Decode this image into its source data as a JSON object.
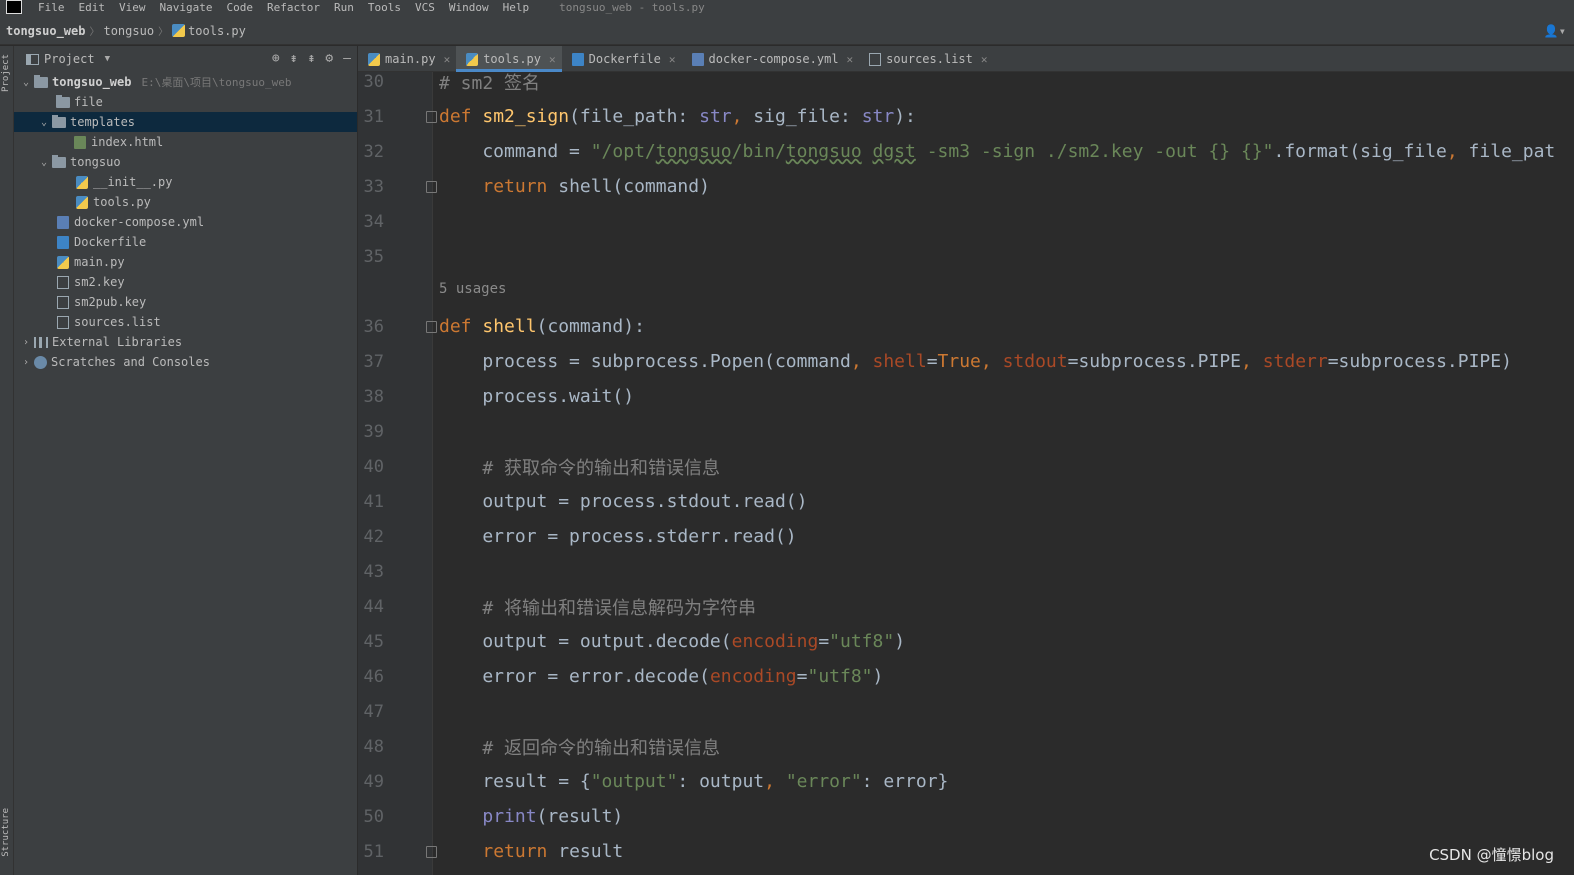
{
  "menubar": {
    "items": [
      "File",
      "Edit",
      "View",
      "Navigate",
      "Code",
      "Refactor",
      "Run",
      "Tools",
      "VCS",
      "Window",
      "Help"
    ],
    "window_title": "tongsuo_web - tools.py"
  },
  "breadcrumb": {
    "project": "tongsuo_web",
    "folder": "tongsuo",
    "file": "tools.py"
  },
  "left_strip": {
    "project_label": "Project",
    "structure_label": "Structure"
  },
  "project_panel": {
    "title": "Project",
    "tree": [
      {
        "label": "tongsuo_web",
        "path": "E:\\桌面\\项目\\tongsuo_web",
        "expanded": true
      },
      {
        "label": "file"
      },
      {
        "label": "templates",
        "expanded": true,
        "selected": true
      },
      {
        "label": "index.html"
      },
      {
        "label": "tongsuo",
        "expanded": true
      },
      {
        "label": "__init__.py"
      },
      {
        "label": "tools.py"
      },
      {
        "label": "docker-compose.yml"
      },
      {
        "label": "Dockerfile"
      },
      {
        "label": "main.py"
      },
      {
        "label": "sm2.key"
      },
      {
        "label": "sm2pub.key"
      },
      {
        "label": "sources.list"
      },
      {
        "label": "External Libraries"
      },
      {
        "label": "Scratches and Consoles"
      }
    ]
  },
  "tabs": [
    {
      "label": "main.py",
      "icon": "python-file-icon"
    },
    {
      "label": "tools.py",
      "icon": "python-file-icon",
      "active": true
    },
    {
      "label": "Dockerfile",
      "icon": "docker-file-icon"
    },
    {
      "label": "docker-compose.yml",
      "icon": "docker-compose-icon"
    },
    {
      "label": "sources.list",
      "icon": "text-file-icon"
    }
  ],
  "editor": {
    "usages_hint": "5 usages",
    "lines": [
      {
        "n": "30",
        "text": "# sm2 签名"
      },
      {
        "n": "31",
        "text": "def sm2_sign(file_path: str, sig_file: str):"
      },
      {
        "n": "32",
        "text": "    command = \"/opt/tongsuo/bin/tongsuo dgst -sm3 -sign ./sm2.key -out {} {}\".format(sig_file, file_pat"
      },
      {
        "n": "33",
        "text": "    return shell(command)"
      },
      {
        "n": "34",
        "text": ""
      },
      {
        "n": "35",
        "text": ""
      },
      {
        "n": "36",
        "text": "def shell(command):"
      },
      {
        "n": "37",
        "text": "    process = subprocess.Popen(command, shell=True, stdout=subprocess.PIPE, stderr=subprocess.PIPE)"
      },
      {
        "n": "38",
        "text": "    process.wait()"
      },
      {
        "n": "39",
        "text": ""
      },
      {
        "n": "40",
        "text": "    # 获取命令的输出和错误信息"
      },
      {
        "n": "41",
        "text": "    output = process.stdout.read()"
      },
      {
        "n": "42",
        "text": "    error = process.stderr.read()"
      },
      {
        "n": "43",
        "text": ""
      },
      {
        "n": "44",
        "text": "    # 将输出和错误信息解码为字符串"
      },
      {
        "n": "45",
        "text": "    output = output.decode(encoding=\"utf8\")"
      },
      {
        "n": "46",
        "text": "    error = error.decode(encoding=\"utf8\")"
      },
      {
        "n": "47",
        "text": ""
      },
      {
        "n": "48",
        "text": "    # 返回命令的输出和错误信息"
      },
      {
        "n": "49",
        "text": "    result = {\"output\": output, \"error\": error}"
      },
      {
        "n": "50",
        "text": "    print(result)"
      },
      {
        "n": "51",
        "text": "    return result"
      }
    ]
  },
  "watermark": "CSDN @憧憬blog",
  "colors": {
    "keyword": "#cc7832",
    "function": "#ffc66d",
    "string": "#6a8759",
    "comment": "#808080",
    "builtin": "#8888c6",
    "param": "#aa4926",
    "accent": "#4a88c7"
  }
}
